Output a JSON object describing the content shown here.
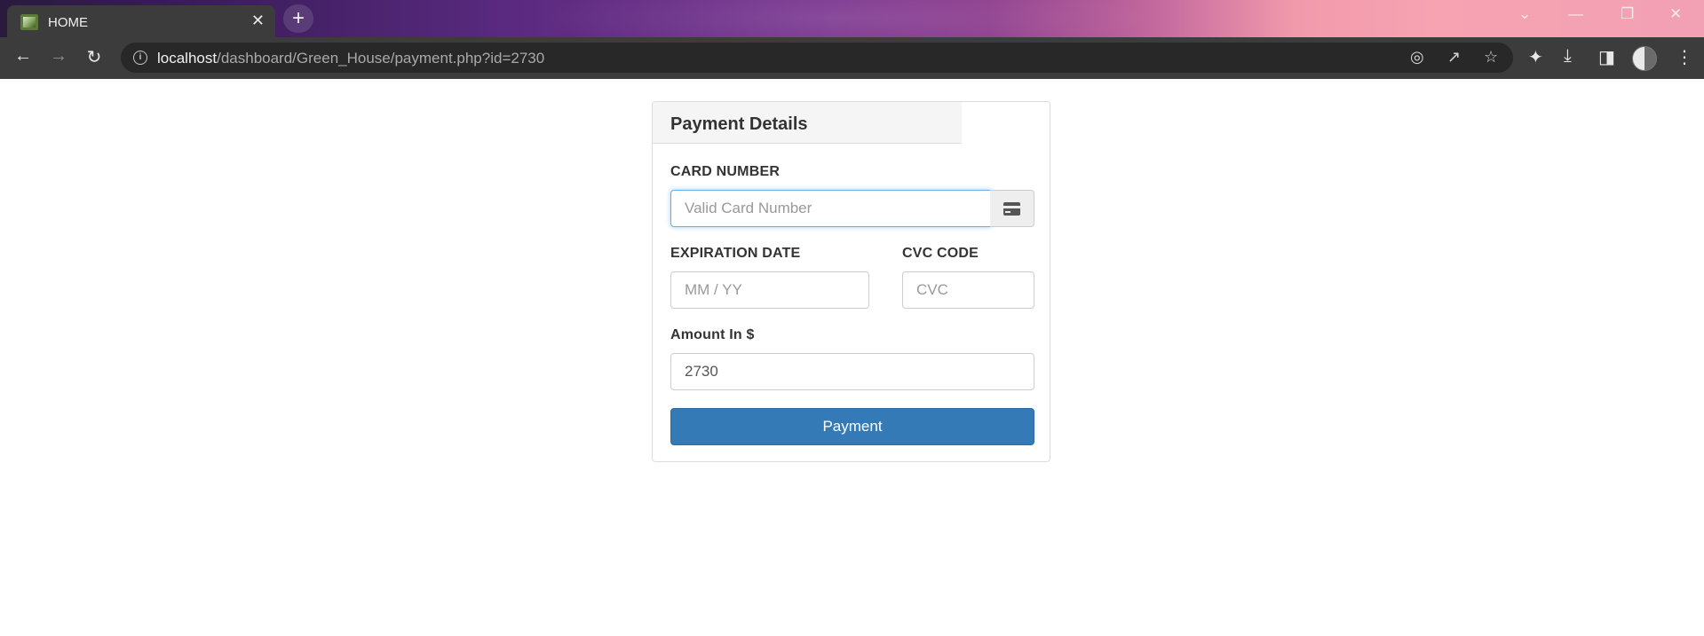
{
  "browser": {
    "tab_title": "HOME",
    "tab_close": "✕",
    "new_tab": "+",
    "url_host": "localhost",
    "url_path": "/dashboard/Green_House/payment.php?id=2730"
  },
  "panel": {
    "title": "Payment Details",
    "card_number_label": "CARD NUMBER",
    "card_number_placeholder": "Valid Card Number",
    "expiration_label": "EXPIRATION DATE",
    "expiration_placeholder": "MM / YY",
    "cvc_label": "CVC CODE",
    "cvc_placeholder": "CVC",
    "amount_label": "Amount In $",
    "amount_value": "2730",
    "submit_label": "Payment"
  },
  "colors": {
    "primary_button": "#337ab7",
    "focus_border": "#66afe9",
    "browser_toolbar": "#3c3c3c"
  },
  "icons": [
    "site-favicon",
    "close-icon",
    "plus-icon",
    "back-icon",
    "forward-icon",
    "reload-icon",
    "info-icon",
    "eye-off-icon",
    "share-icon",
    "star-icon",
    "puzzle-icon",
    "download-icon",
    "sidebar-icon",
    "avatar",
    "more-icon",
    "credit-card-icon"
  ]
}
